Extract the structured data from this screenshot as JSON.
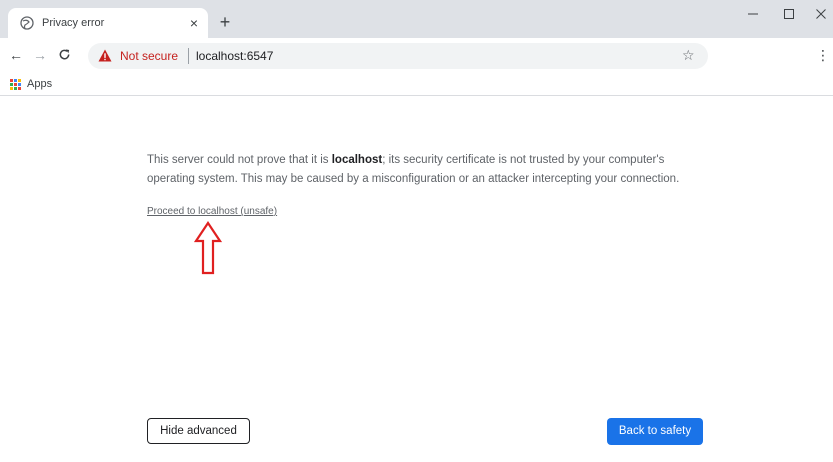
{
  "tab": {
    "title": "Privacy error",
    "close_glyph": "×",
    "icon": "globe-icon"
  },
  "new_tab_glyph": "+",
  "window_controls": {
    "minimize_glyph": "–",
    "maximize_glyph": "☐",
    "close_glyph": "×"
  },
  "toolbar": {
    "back_glyph": "←",
    "forward_glyph": "→",
    "reload_glyph": "C",
    "security_text": "Not secure",
    "url": "localhost:6547",
    "star_glyph": "☆",
    "menu_glyph": "⋮"
  },
  "bookmarks": {
    "apps_label": "Apps"
  },
  "content": {
    "explanation_before": "This server could not prove that it is ",
    "explanation_host": "localhost",
    "explanation_after": "; its security certificate is not trusted by your computer's operating system. This may be caused by a misconfiguration or an attacker intercepting your connection.",
    "proceed_link": "Proceed to localhost (unsafe)",
    "hide_advanced_label": "Hide advanced",
    "back_to_safety_label": "Back to safety"
  },
  "colors": {
    "warning_red": "#c5221f",
    "primary_blue": "#1a73e8",
    "annotation_arrow": "#e02020"
  }
}
